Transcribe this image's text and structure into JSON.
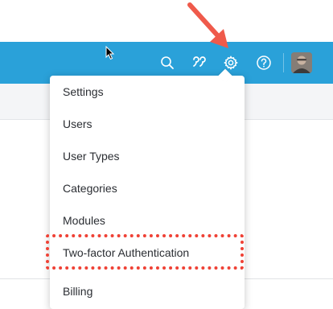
{
  "toolbar": {
    "icons": [
      "search-icon",
      "quote-icon",
      "gear-icon",
      "help-icon"
    ],
    "accent_color": "#2aa1d9"
  },
  "user_menu": {
    "avatar": "user-avatar"
  },
  "dropdown": {
    "items": [
      {
        "label": "Settings"
      },
      {
        "label": "Users"
      },
      {
        "label": "User Types"
      },
      {
        "label": "Categories"
      },
      {
        "label": "Modules"
      },
      {
        "label": "Two-factor Authentication"
      },
      {
        "label": "Billing"
      }
    ]
  },
  "annotation": {
    "arrow_color": "#ef5a4b",
    "highlight_color": "#ef4135"
  }
}
